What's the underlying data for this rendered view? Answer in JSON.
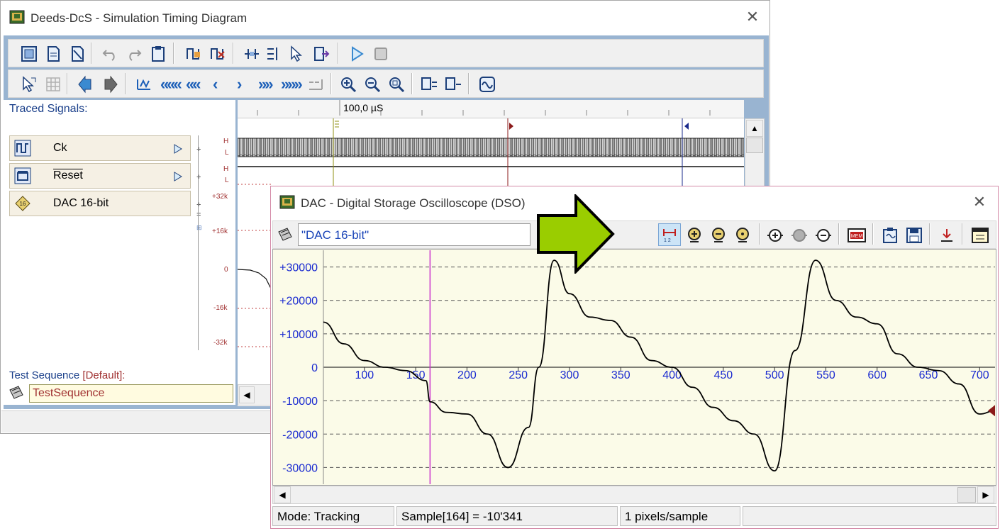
{
  "timing_window": {
    "title": "Deeds-DcS  -  Simulation Timing Diagram",
    "close_glyph": "✕",
    "traced_signals_label": "Traced Signals:",
    "ruler_label": "100,0 µS",
    "signals": [
      {
        "name": "Ck",
        "icon": "clock-signal-icon"
      },
      {
        "name": "Reset",
        "icon": "reset-signal-icon"
      },
      {
        "name": "DAC 16-bit",
        "icon": "dac-16bit-icon"
      }
    ],
    "hl_labels": {
      "h": "H",
      "l": "L"
    },
    "y_labels": [
      "+32k",
      "+16k",
      "0",
      "-16k",
      "-32k"
    ],
    "test_sequence_label": "Test Sequence",
    "test_sequence_default": "[Default]:",
    "test_sequence_value": "TestSequence"
  },
  "dso_window": {
    "title": "DAC - Digital Storage Oscilloscope (DSO)",
    "close_glyph": "✕",
    "signal_name": "\"DAC 16-bit\"",
    "status": {
      "mode": "Mode: Tracking",
      "sample": "Sample[164] = -10'341",
      "scale": "1 pixels/sample"
    }
  },
  "chart_data": {
    "type": "line",
    "xlim": [
      60,
      715
    ],
    "ylim": [
      -35000,
      35000
    ],
    "x_ticks": [
      100,
      150,
      200,
      250,
      300,
      350,
      400,
      450,
      500,
      550,
      600,
      650,
      700
    ],
    "y_ticks": [
      30000,
      20000,
      10000,
      0,
      -10000,
      -20000,
      -30000
    ],
    "y_tick_labels": [
      "+30000",
      "+20000",
      "+10000",
      "0",
      "-10000",
      "-20000",
      "-30000"
    ],
    "grid": true,
    "cursor_x": 164,
    "series": [
      {
        "x": [
          60,
          80,
          100,
          120,
          140,
          160,
          164,
          180,
          200,
          220,
          240,
          260,
          270,
          285,
          300,
          320,
          340,
          360,
          380,
          400,
          420,
          440,
          460,
          480,
          500,
          520,
          540,
          560,
          580,
          600,
          620,
          640,
          660,
          680,
          700,
          715
        ],
        "values": [
          13500,
          7000,
          2000,
          0,
          -1000,
          -4000,
          -10341,
          -13500,
          -14000,
          -20000,
          -30000,
          -18000,
          0,
          32000,
          22000,
          15000,
          14000,
          9000,
          2000,
          0,
          -6000,
          -12000,
          -16000,
          -20000,
          -31000,
          5000,
          32000,
          20000,
          15000,
          13000,
          4000,
          0,
          -1000,
          -5000,
          -14000,
          -13000
        ]
      }
    ]
  },
  "colors": {
    "trace": "#000000",
    "cursor": "#cc33cc",
    "axis_labels_x": "#1a2ad0",
    "axis_labels_y": "#1a2ad0",
    "arrow_fill": "#9acd00",
    "marker_red": "#8b1a1a",
    "marker_blue": "#1a2a8b",
    "marker_olive": "#8f8f10"
  }
}
